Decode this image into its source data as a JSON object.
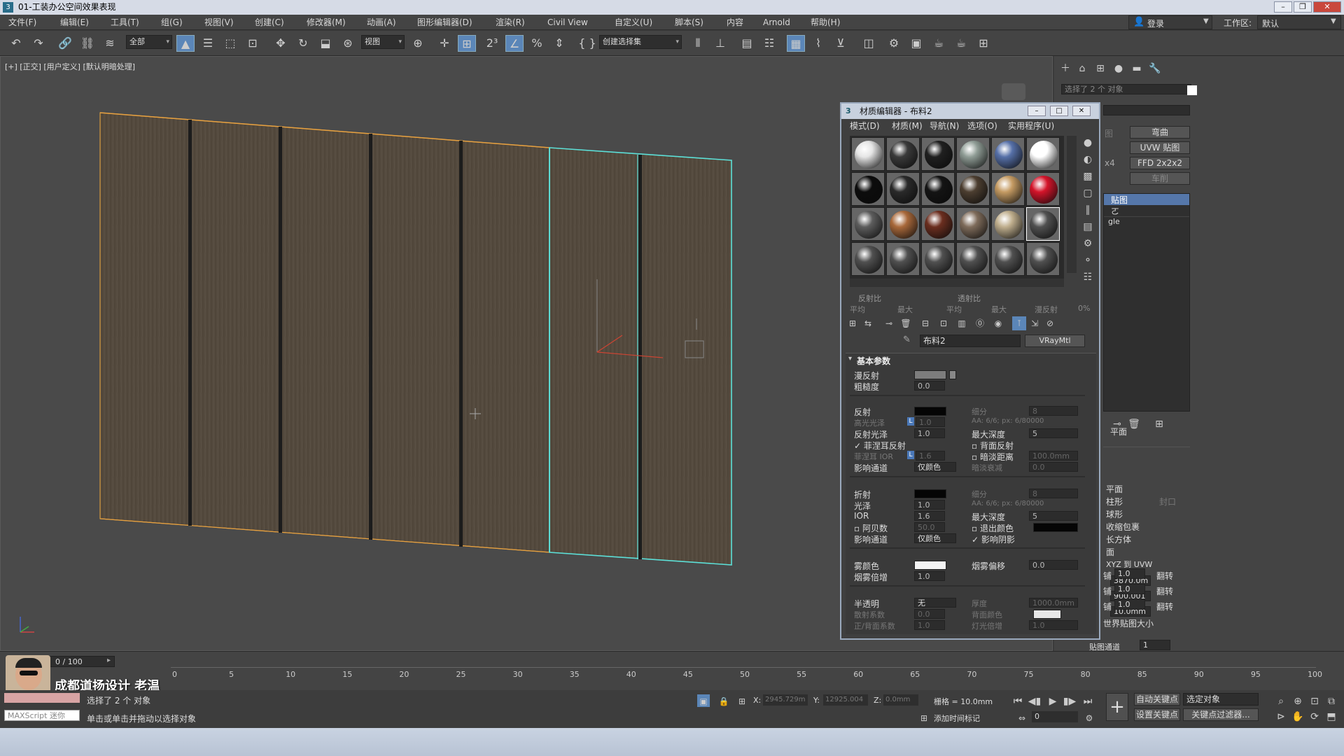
{
  "window": {
    "title": "01-工装办公空间效果表现"
  },
  "menus": [
    "文件(F)",
    "编辑(E)",
    "工具(T)",
    "组(G)",
    "视图(V)",
    "创建(C)",
    "修改器(M)",
    "动画(A)",
    "图形编辑器(D)",
    "渲染(R)",
    "Civil View",
    "自定义(U)",
    "脚本(S)",
    "内容",
    "Arnold",
    "帮助(H)"
  ],
  "account": {
    "login": "登录",
    "workspace_label": "工作区:",
    "workspace_value": "默认"
  },
  "toolbar": {
    "selection_filter": "全部",
    "ref_coord": "视图",
    "named_selection": "创建选择集"
  },
  "viewport": {
    "label": "[+] [正交] [用户定义] [默认明暗处理]"
  },
  "material_editor": {
    "title": "材质编辑器 - 布料2",
    "menus": [
      "模式(D)",
      "材质(M)",
      "导航(N)",
      "选项(O)",
      "实用程序(U)"
    ],
    "swatches": [
      "#e5e5e5",
      "#3a3a3a",
      "#202020",
      "#8f9c95",
      "#5670a8",
      "#ffffff",
      "#0c0c0c",
      "#2a2a2a",
      "#141414",
      "#4c3e30",
      "#c59b63",
      "#d4142a",
      "#5d5d5d",
      "#a8683a",
      "#6b2e1f",
      "#7e6b5a",
      "#bfae8d",
      "#505050",
      "#505050",
      "#505050",
      "#505050",
      "#505050",
      "#505050",
      "#505050"
    ],
    "ratio_labels": {
      "reflect": "反射比",
      "refract": "透射比",
      "avg1": "平均",
      "max1": "最大",
      "avg2": "平均",
      "max2": "最大",
      "diffuse": "漫反射",
      "diffuse_pct": "0%"
    },
    "material_name": "布料2",
    "material_type": "VRayMtl",
    "rollout_title": "基本参数",
    "params": {
      "diffuse": "漫反射",
      "roughness": "粗糙度",
      "roughness_val": "0.0",
      "reflect": "反射",
      "subdiv": "细分",
      "subdiv_val": "8",
      "hilight_gloss": "高光光泽",
      "hilight_val": "1.0",
      "aa_label": "AA: 6/6; px: 6/80000",
      "refl_gloss": "反射光泽",
      "refl_gloss_val": "1.0",
      "max_depth": "最大深度",
      "max_depth_val": "5",
      "fresnel": "菲涅耳反射",
      "back_reflect": "背面反射",
      "fresnel_ior": "菲涅耳 IOR",
      "fresnel_ior_val": "1.6",
      "dim_distance": "暗淡距离",
      "dim_distance_val": "100.0mm",
      "affect_channels": "影响通道",
      "color_only": "仅颜色",
      "dim_falloff": "暗淡衰减",
      "dim_falloff_val": "0.0",
      "refract": "折射",
      "refr_subdiv_val": "8",
      "gloss": "光泽",
      "gloss_val": "1.0",
      "aa_label2": "AA: 6/6; px: 6/80000",
      "ior": "IOR",
      "ior_val": "1.6",
      "refr_max_depth_val": "5",
      "abbe": "阿贝数",
      "abbe_val": "50.0",
      "exit_color": "退出颜色",
      "affect_channels2": "影响通道",
      "color_only2": "仅颜色",
      "affect_shadows": "影响阴影",
      "fog_color": "雾颜色",
      "fog_bias": "烟雾偏移",
      "fog_bias_val": "0.0",
      "fog_mult": "烟雾倍增",
      "fog_mult_val": "1.0",
      "translucency": "半透明",
      "translucency_val": "无",
      "thickness": "厚度",
      "thickness_val": "1000.0mm",
      "scatter_coef": "散射系数",
      "scatter_val": "0.0",
      "back_color": "背面颜色",
      "fwd_bck": "正/背面系数",
      "fwd_bck_val": "1.0",
      "light_mult": "灯光倍增",
      "light_mult_val": "1.0"
    }
  },
  "command_panel": {
    "selected": "选择了 2 个 对象",
    "btn_bend": "弯曲",
    "btn_uvw": "UVW 贴图",
    "btn_ffd": "FFD 2x2x2",
    "btn_lathe": "车削",
    "lbl_map": "图",
    "lbl_x4": "x4",
    "stack_selected": "贴图",
    "stack_item": "gle",
    "mapping": [
      "平面",
      "柱形",
      "球形",
      "收缩包裹",
      "长方体",
      "面",
      "XYZ 到 UVW"
    ],
    "cap_label": "封口",
    "length": "3870.0m",
    "width": "900.001",
    "height": "10.0mm",
    "tile_lbls": [
      "铺",
      "铺",
      "铺"
    ],
    "tile_vals": [
      "1.0",
      "1.0",
      "1.0"
    ],
    "flip": [
      "翻转",
      "翻转",
      "翻转"
    ],
    "real_world": "世界贴图大小",
    "map_channel": "贴图通道",
    "map_channel_val": "1"
  },
  "timeline": {
    "frame": "0 / 100",
    "ticks": [
      "0",
      "5",
      "10",
      "15",
      "20",
      "25",
      "30",
      "35",
      "40",
      "45",
      "50",
      "55",
      "60",
      "65",
      "70",
      "75",
      "80",
      "85",
      "90",
      "95",
      "100"
    ],
    "watermark": "成都道扬设计  老温"
  },
  "status": {
    "maxscript": "MAXScript 迷你",
    "selected": "选择了 2 个 对象",
    "prompt": "单击或单击并拖动以选择对象",
    "x_label": "X:",
    "x_val": "2945.729m",
    "y_label": "Y:",
    "y_val": "12925.004",
    "z_label": "Z:",
    "z_val": "0.0mm",
    "grid": "栅格 = 10.0mm",
    "add_time_tag": "添加时间标记",
    "auto_key": "自动关键点",
    "set_key": "设置关键点",
    "key_filter": "选定对象",
    "key_filters": "关键点过滤器...",
    "frame_val": "0"
  }
}
